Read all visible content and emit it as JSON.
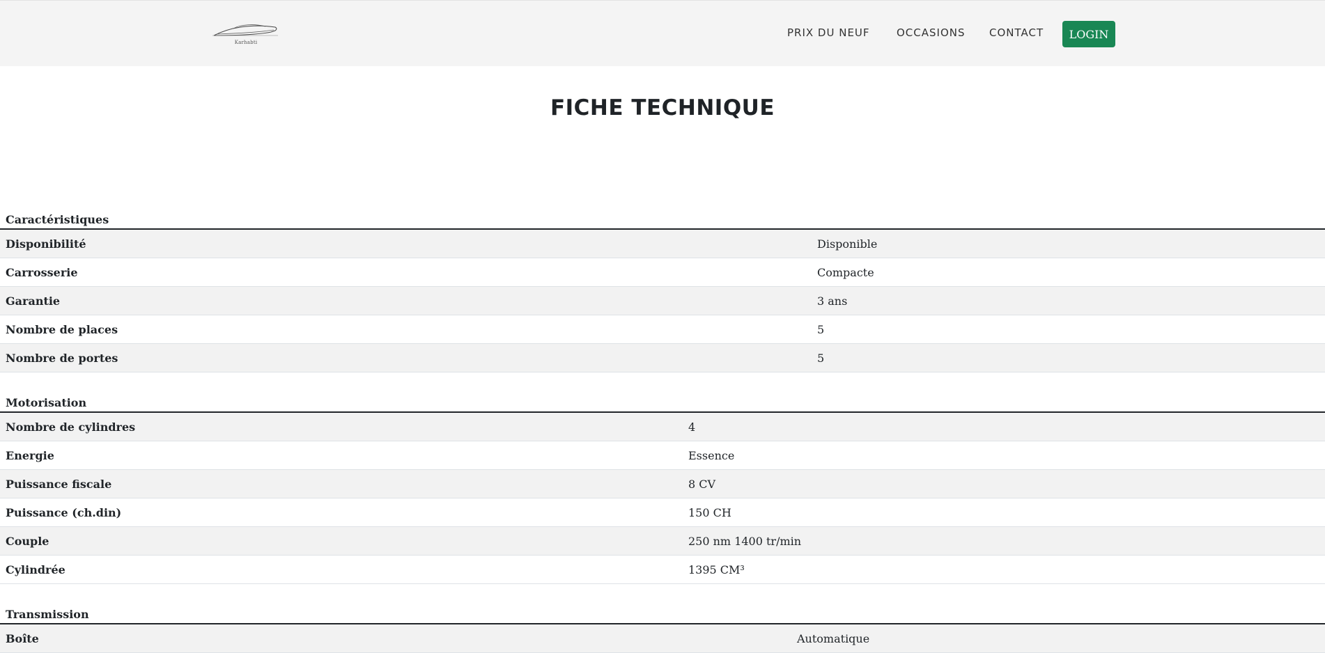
{
  "nav": {
    "logo_text": "Karhabti",
    "links": [
      "PRIX DU NEUF",
      "OCCASIONS",
      "CONTACT"
    ],
    "login_label": "LOGIN",
    "login_color": "#198754"
  },
  "page_title": "FICHE TECHNIQUE",
  "sections": {
    "caracteristiques": {
      "title": "Caractéristiques",
      "rows": [
        {
          "label": "Disponibilité",
          "value": "Disponible"
        },
        {
          "label": "Carrosserie",
          "value": "Compacte"
        },
        {
          "label": "Garantie",
          "value": "3 ans"
        },
        {
          "label": "Nombre de places",
          "value": "5"
        },
        {
          "label": "Nombre de portes",
          "value": "5"
        }
      ]
    },
    "motorisation": {
      "title": "Motorisation",
      "rows": [
        {
          "label": "Nombre de cylindres",
          "value": "4"
        },
        {
          "label": "Energie",
          "value": "Essence"
        },
        {
          "label": "Puissance fiscale",
          "value": "8 CV"
        },
        {
          "label": "Puissance (ch.din)",
          "value": "150 CH"
        },
        {
          "label": "Couple",
          "value": "250 nm 1400 tr/min"
        },
        {
          "label": "Cylindrée",
          "value": "1395 CM³"
        }
      ]
    },
    "transmission": {
      "title": "Transmission",
      "rows": [
        {
          "label": "Boîte",
          "value": "Automatique"
        }
      ]
    }
  }
}
